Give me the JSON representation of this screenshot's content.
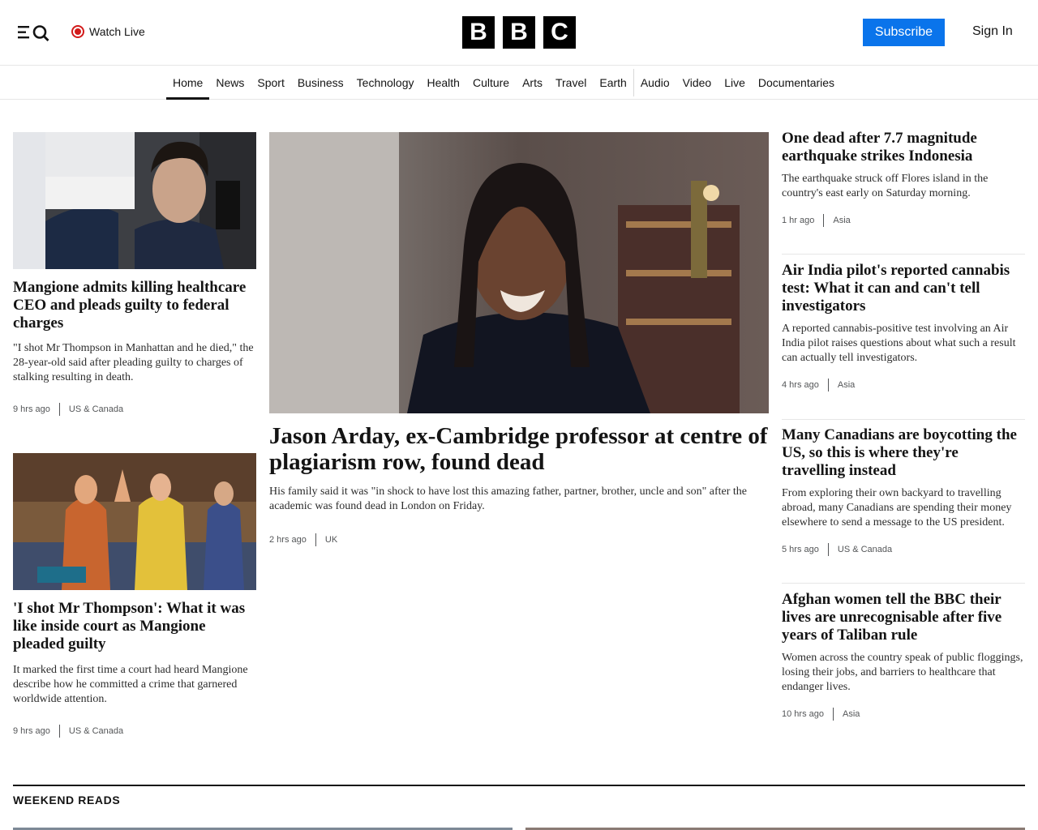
{
  "header": {
    "watch_live": "Watch Live",
    "logo_letters": [
      "B",
      "B",
      "C"
    ],
    "subscribe": "Subscribe",
    "sign_in": "Sign In"
  },
  "nav": {
    "items": [
      "Home",
      "News",
      "Sport",
      "Business",
      "Technology",
      "Health",
      "Culture",
      "Arts",
      "Travel",
      "Earth",
      "Audio",
      "Video",
      "Live",
      "Documentaries"
    ],
    "active": "Home"
  },
  "left_stories": [
    {
      "headline": "Mangione admits killing healthcare CEO and pleads guilty to federal charges",
      "summary": "\"I shot Mr Thompson in Manhattan and he died,\" the 28-year-old said after pleading guilty to charges of stalking resulting in death.",
      "time": "9 hrs ago",
      "section": "US & Canada"
    },
    {
      "headline": "'I shot Mr Thompson': What it was like inside court as Mangione pleaded guilty",
      "summary": "It marked the first time a court had heard Mangione describe how he committed a crime that garnered worldwide attention.",
      "time": "9 hrs ago",
      "section": "US & Canada"
    }
  ],
  "main_story": {
    "headline": "Jason Arday, ex-Cambridge professor at centre of plagiarism row, found dead",
    "summary": "His family said it was \"in shock to have lost this amazing father, partner, brother, uncle and son\" after the academic was found dead in London on Friday.",
    "time": "2 hrs ago",
    "section": "UK"
  },
  "right_stories": [
    {
      "headline": "One dead after 7.7 magnitude earthquake strikes Indonesia",
      "summary": "The earthquake struck off Flores island in the country's east early on Saturday morning.",
      "time": "1 hr ago",
      "section": "Asia"
    },
    {
      "headline": "Air India pilot's reported cannabis test: What it can and can't tell investigators",
      "summary": "A reported cannabis-positive test involving an Air India pilot raises questions about what such a result can actually tell investigators.",
      "time": "4 hrs ago",
      "section": "Asia"
    },
    {
      "headline": "Many Canadians are boycotting the US, so this is where they're travelling instead",
      "summary": "From exploring their own backyard to travelling abroad, many Canadians are spending their money elsewhere to send a message to the US president.",
      "time": "5 hrs ago",
      "section": "US & Canada"
    },
    {
      "headline": "Afghan women tell the BBC their lives are unrecognisable after five years of Taliban rule",
      "summary": "Women across the country speak of public floggings, losing their jobs, and barriers to healthcare that endanger lives.",
      "time": "10 hrs ago",
      "section": "Asia"
    }
  ],
  "weekend": {
    "title": "WEEKEND READS"
  },
  "colors": {
    "accent": "#0a74eb",
    "live_red": "#d21a1a",
    "text": "#141414",
    "meta": "#545658"
  }
}
